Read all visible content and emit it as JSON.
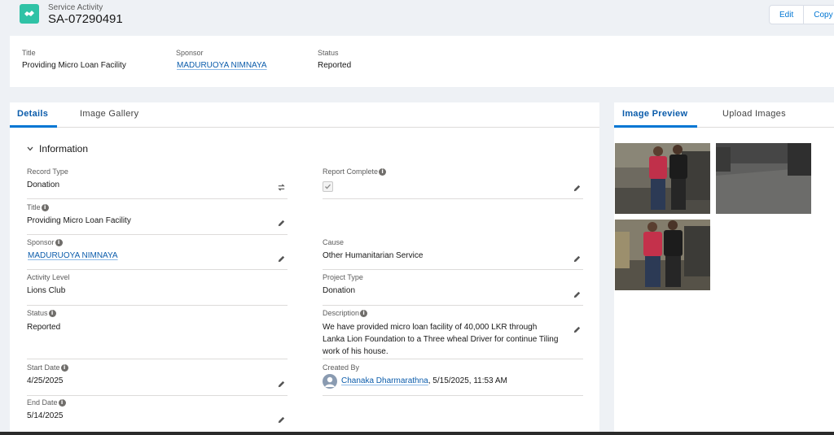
{
  "header": {
    "object_type": "Service Activity",
    "record_name": "SA-07290491",
    "actions": [
      "Edit",
      "Copy"
    ]
  },
  "highlights": {
    "title_label": "Title",
    "title_value": "Providing Micro Loan Facility",
    "sponsor_label": "Sponsor",
    "sponsor_value": "MADURUOYA NIMNAYA",
    "status_label": "Status",
    "status_value": "Reported"
  },
  "main_tabs": [
    "Details",
    "Image Gallery"
  ],
  "section": {
    "title": "Information"
  },
  "fields": {
    "record_type": {
      "label": "Record Type",
      "value": "Donation"
    },
    "report_complete": {
      "label": "Report Complete",
      "checked": true
    },
    "title": {
      "label": "Title",
      "value": "Providing Micro Loan Facility"
    },
    "sponsor": {
      "label": "Sponsor",
      "value": "MADURUOYA NIMNAYA"
    },
    "cause": {
      "label": "Cause",
      "value": "Other Humanitarian Service"
    },
    "activity_level": {
      "label": "Activity Level",
      "value": "Lions Club"
    },
    "project_type": {
      "label": "Project Type",
      "value": "Donation"
    },
    "status": {
      "label": "Status",
      "value": "Reported"
    },
    "description": {
      "label": "Description",
      "value": "We have provided micro loan facility of 40,000 LKR through Lanka Lion Foundation to a Three wheal Driver for continue Tiling work of his house."
    },
    "start_date": {
      "label": "Start Date",
      "value": "4/25/2025"
    },
    "created_by": {
      "label": "Created By",
      "user": "Chanaka Dharmarathna",
      "timestamp": ", 5/15/2025, 11:53 AM"
    },
    "end_date": {
      "label": "End Date",
      "value": "5/14/2025"
    }
  },
  "side_tabs": [
    "Image Preview",
    "Upload Images"
  ],
  "colors": {
    "brand_blue": "#0176d3",
    "link": "#0b5cab",
    "object_icon": "#2fc2a6"
  }
}
